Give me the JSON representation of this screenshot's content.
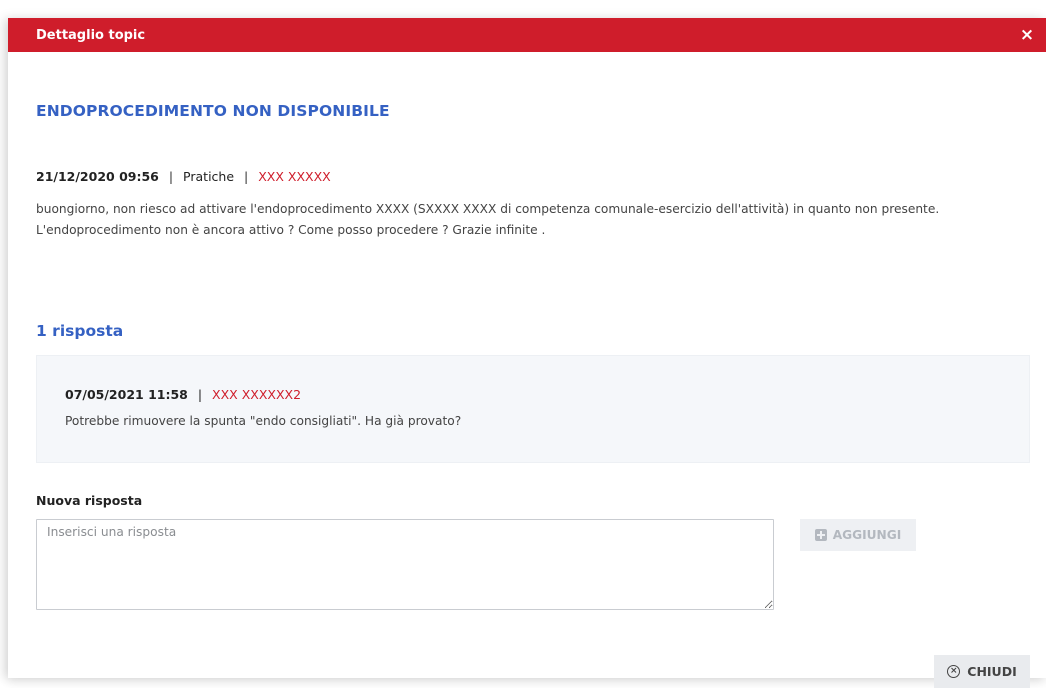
{
  "dialog": {
    "title": "Dettaglio topic",
    "close_icon": "×"
  },
  "topic": {
    "title": "ENDOPROCEDIMENTO NON DISPONIBILE",
    "date": "21/12/2020 09:56",
    "category": "Pratiche",
    "author": "XXX XXXXX",
    "text": "buongiorno, non riesco ad attivare l'endoprocedimento XXXX (SXXXX XXXX di competenza comunale-esercizio dell'attività) in quanto non presente. L'endoprocedimento non è ancora attivo ? Come posso procedere ? Grazie infinite ."
  },
  "answers": {
    "count_label": "1 risposta",
    "items": [
      {
        "date": "07/05/2021 11:58",
        "author": "XXX XXXXXX2",
        "text": "Potrebbe rimuovere la spunta \"endo consigliati\". Ha già provato?"
      }
    ]
  },
  "reply": {
    "label": "Nuova risposta",
    "placeholder": "Inserisci una risposta",
    "value": "",
    "add_label": "AGGIUNGI",
    "add_icon": "plus-square-icon"
  },
  "footer": {
    "close_label": "CHIUDI",
    "close_icon": "circle-x-icon"
  },
  "colors": {
    "header": "#cf1d2b",
    "title_blue": "#3561c3",
    "author_red": "#cf1d2b"
  }
}
